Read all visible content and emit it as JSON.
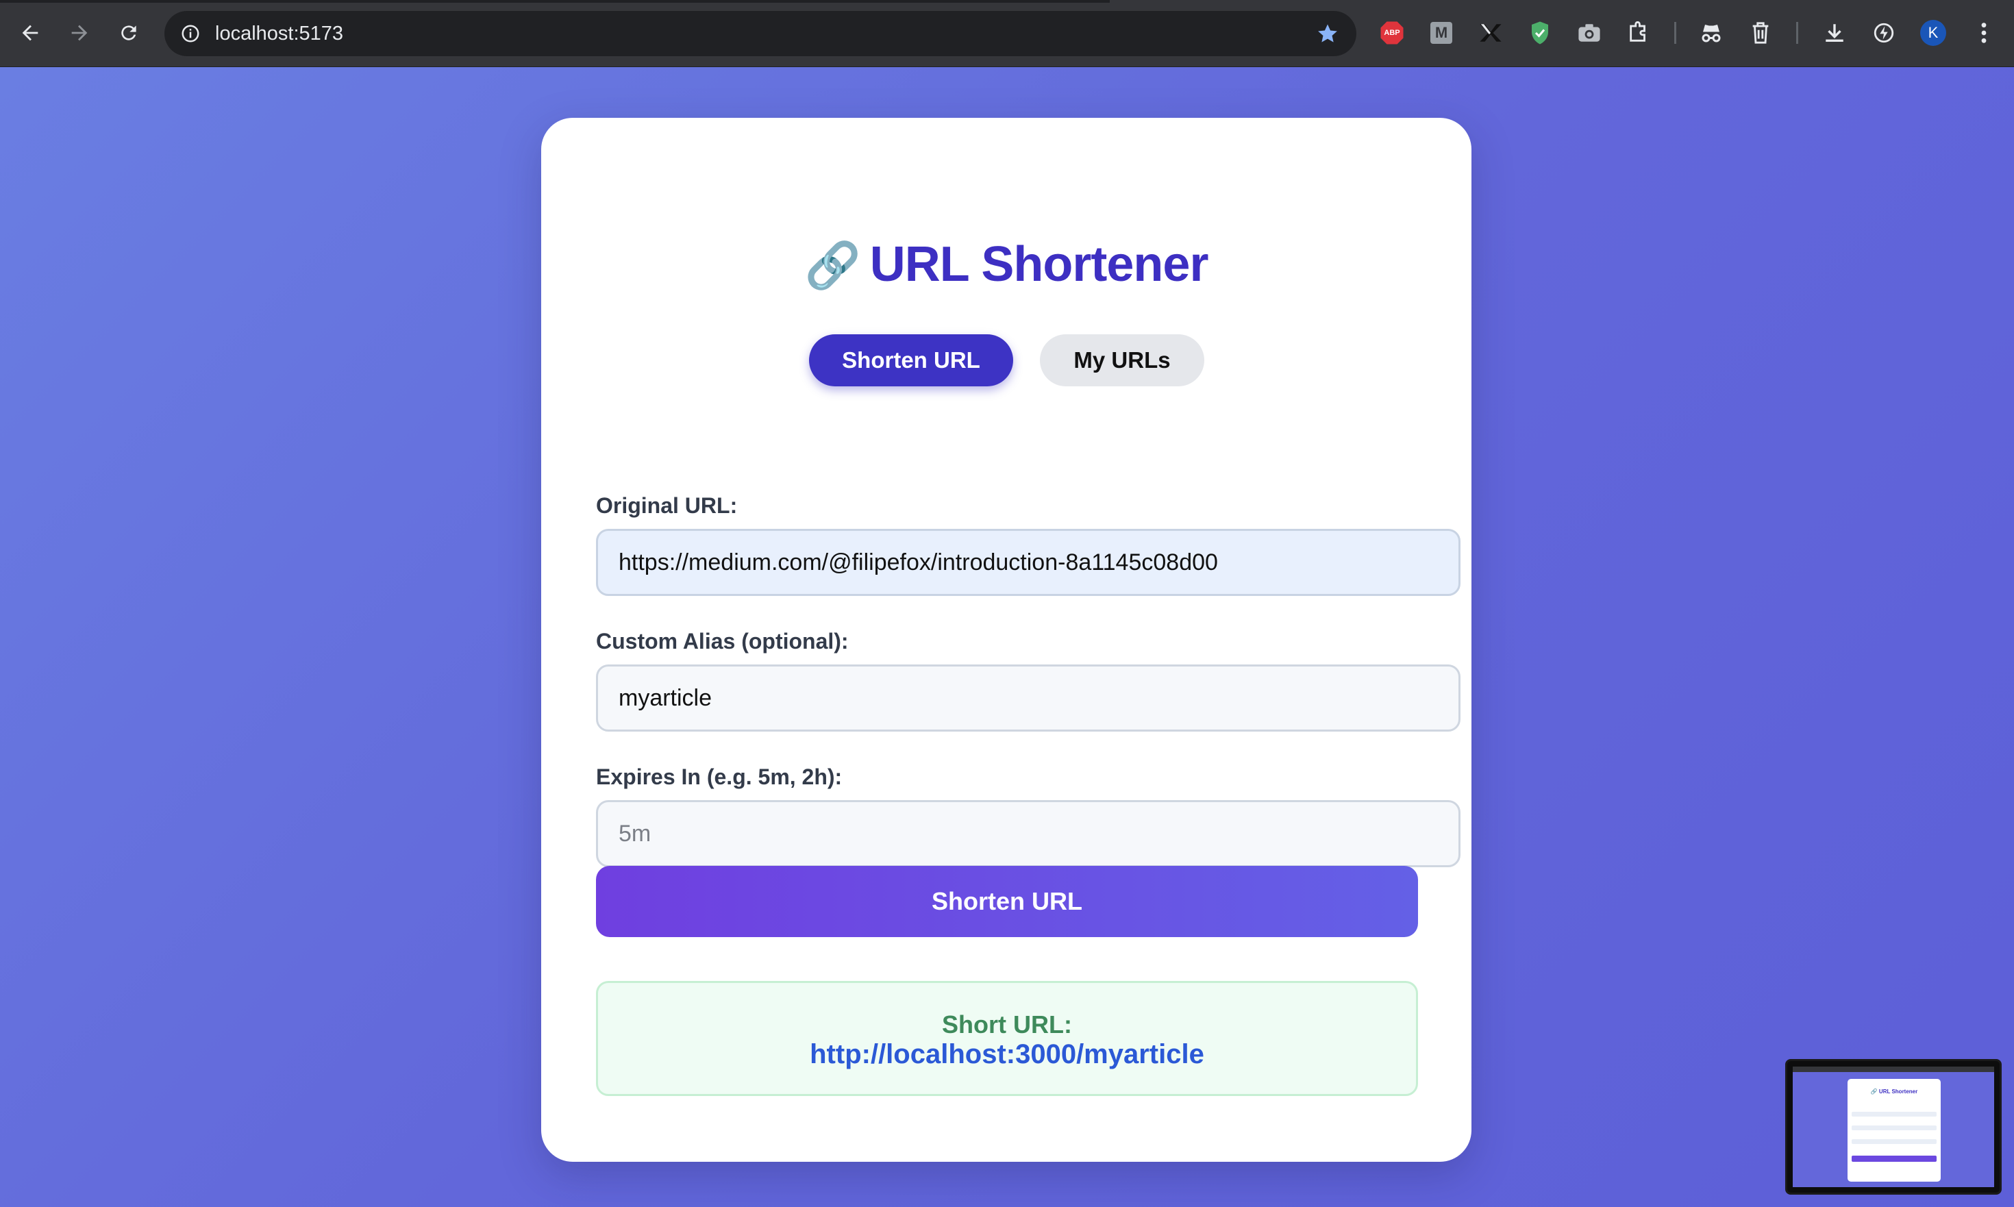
{
  "browser": {
    "url": "localhost:5173",
    "profile_initial": "K",
    "extensions": [
      "abp-icon",
      "m-icon",
      "x-icon",
      "shield-icon",
      "camera-icon",
      "puzzle-icon",
      "incognito-icon",
      "trash-icon",
      "download-icon",
      "performance-icon"
    ],
    "abp_label": "ABP",
    "m_label": "M"
  },
  "app": {
    "title_icon": "🔗",
    "title": "URL Shortener",
    "tabs": [
      {
        "label": "Shorten URL",
        "active": true
      },
      {
        "label": "My URLs",
        "active": false
      }
    ],
    "form": {
      "original_url_label": "Original URL:",
      "original_url_value": "https://medium.com/@filipefox/introduction-8a1145c08d00",
      "alias_label": "Custom Alias (optional):",
      "alias_value": "myarticle",
      "expires_label": "Expires In (e.g. 5m, 2h):",
      "expires_placeholder": "5m",
      "submit_label": "Shorten URL"
    },
    "result": {
      "label": "Short URL:",
      "short_url": "http://localhost:3000/myarticle"
    }
  },
  "thumbnail": {
    "title": "🔗 URL Shortener"
  }
}
